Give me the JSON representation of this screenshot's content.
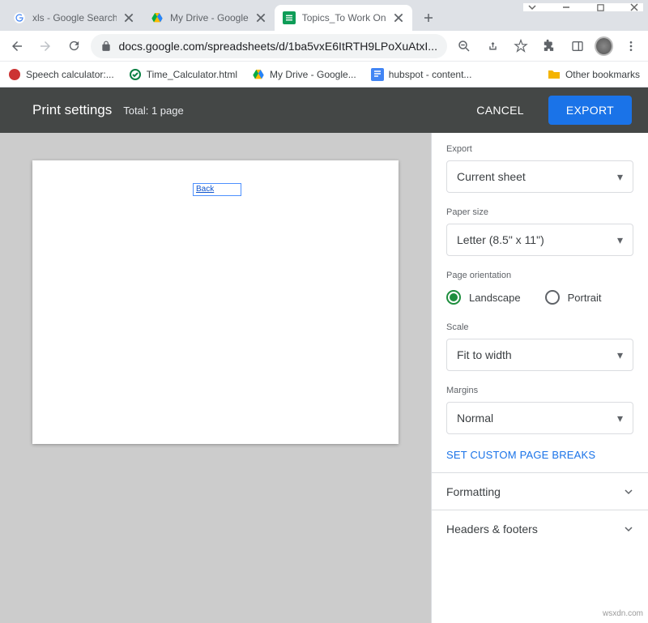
{
  "window": {
    "tabs": [
      {
        "title": "xls - Google Search"
      },
      {
        "title": "My Drive - Google"
      },
      {
        "title": "Topics_To Work On"
      }
    ]
  },
  "addressbar": {
    "url": "docs.google.com/spreadsheets/d/1ba5vxE6ItRTH9LPoXuAtxI..."
  },
  "bookmarks": {
    "items": [
      {
        "label": "Speech calculator:..."
      },
      {
        "label": "Time_Calculator.html"
      },
      {
        "label": "My Drive - Google..."
      },
      {
        "label": "hubspot - content..."
      }
    ],
    "other": "Other bookmarks"
  },
  "header": {
    "title": "Print settings",
    "total_label": "Total:",
    "total_value": "1 page",
    "cancel": "CANCEL",
    "export": "EXPORT"
  },
  "preview": {
    "cell_text": "Back"
  },
  "panel": {
    "export": {
      "label": "Export",
      "value": "Current sheet"
    },
    "paper": {
      "label": "Paper size",
      "value": "Letter (8.5\" x 11\")"
    },
    "orientation": {
      "label": "Page orientation",
      "landscape": "Landscape",
      "portrait": "Portrait"
    },
    "scale": {
      "label": "Scale",
      "value": "Fit to width"
    },
    "margins": {
      "label": "Margins",
      "value": "Normal"
    },
    "custom_breaks": "SET CUSTOM PAGE BREAKS",
    "formatting": "Formatting",
    "headers_footers": "Headers & footers"
  },
  "watermark": "wsxdn.com"
}
